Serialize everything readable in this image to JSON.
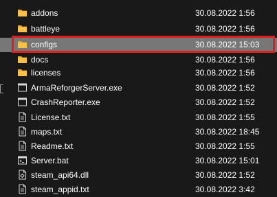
{
  "files": [
    {
      "name": "addons",
      "modified": "30.08.2022 1:56",
      "icon": "folder-icon"
    },
    {
      "name": "battleye",
      "modified": "30.08.2022 1:56",
      "icon": "folder-icon"
    },
    {
      "name": "configs",
      "modified": "30.08.2022 15:03",
      "icon": "folder-icon",
      "selected": true
    },
    {
      "name": "docs",
      "modified": "30.08.2022 1:56",
      "icon": "folder-icon"
    },
    {
      "name": "licenses",
      "modified": "30.08.2022 1:56",
      "icon": "folder-icon"
    },
    {
      "name": "ArmaReforgerServer.exe",
      "modified": "30.08.2022 1:52",
      "icon": "exe-icon"
    },
    {
      "name": "CrashReporter.exe",
      "modified": "30.08.2022 1:52",
      "icon": "exe-icon"
    },
    {
      "name": "License.txt",
      "modified": "30.08.2022 1:55",
      "icon": "text-file-icon"
    },
    {
      "name": "maps.txt",
      "modified": "30.08.2022 18:45",
      "icon": "text-file-icon"
    },
    {
      "name": "Readme.txt",
      "modified": "30.08.2022 1:55",
      "icon": "text-file-icon"
    },
    {
      "name": "Server.bat",
      "modified": "30.08.2022 15:01",
      "icon": "batch-file-icon"
    },
    {
      "name": "steam_api64.dll",
      "modified": "30.08.2022 1:52",
      "icon": "dll-file-icon"
    },
    {
      "name": "steam_appid.txt",
      "modified": "30.08.2022 3:42",
      "icon": "text-file-icon"
    }
  ],
  "colors": {
    "background": "#191919",
    "selection": "#777777",
    "highlight_border": "#e01e1e",
    "folder": "#f6c04b"
  }
}
